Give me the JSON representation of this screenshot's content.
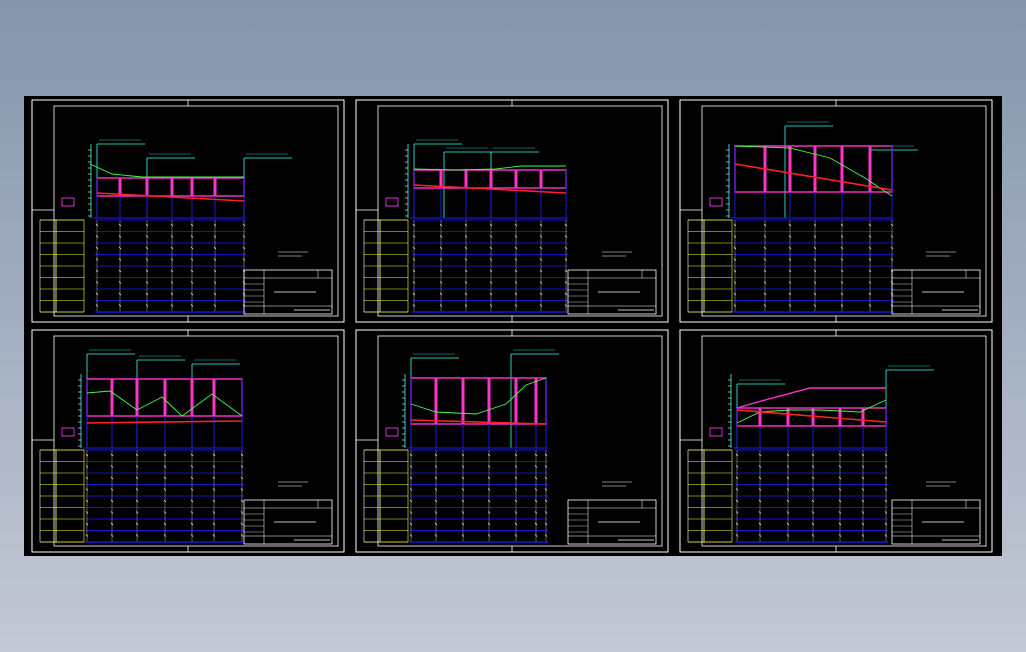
{
  "app": {
    "title": ""
  },
  "viewport": {
    "background": "#000000"
  },
  "colors": {
    "frame": "#ffffff",
    "grid": "#1a1aff",
    "profile_box": "#ff33cc",
    "terrain": "#44ff44",
    "design_line": "#ff2222",
    "label": "#33ffee",
    "legend": "#ffff33",
    "level": "#ff44ff"
  },
  "sheets": [
    {
      "id": "sheet-1",
      "profile": "flat"
    },
    {
      "id": "sheet-2",
      "profile": "flat-short"
    },
    {
      "id": "sheet-3",
      "profile": "sloped-down"
    },
    {
      "id": "sheet-4",
      "profile": "wavy"
    },
    {
      "id": "sheet-5",
      "profile": "rising"
    },
    {
      "id": "sheet-6",
      "profile": "arched"
    }
  ]
}
